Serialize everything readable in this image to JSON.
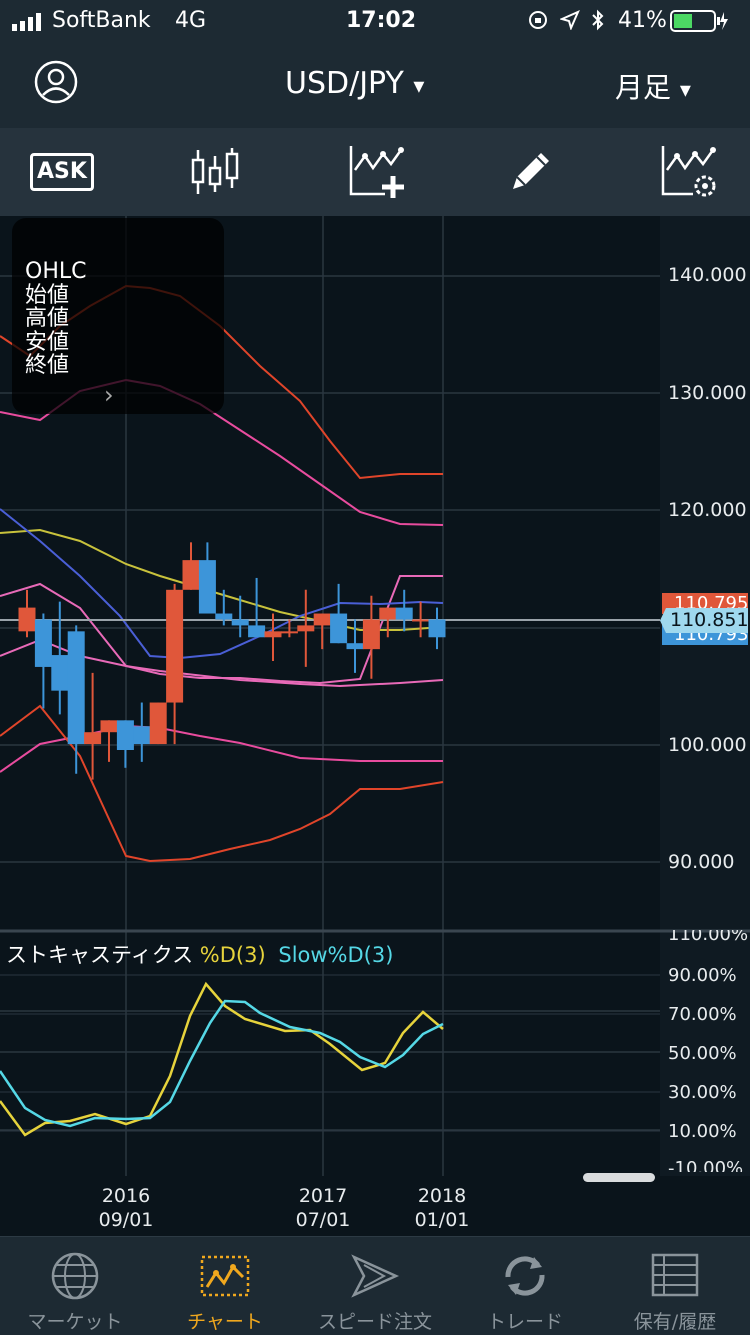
{
  "status_bar": {
    "carrier": "SoftBank",
    "network": "4G",
    "time": "17:02",
    "battery": "41%"
  },
  "header": {
    "pair": "USD/JPY",
    "pair_caret": "▾",
    "period": "月足",
    "period_caret": "▾"
  },
  "toolbar": {
    "ask_label": "ASK"
  },
  "ohlc_box": {
    "title": "OHLC",
    "open": "始値",
    "high": "高値",
    "low": "安値",
    "close": "終値",
    "arrow": "›"
  },
  "price_axis": {
    "ticks": [
      "140.000",
      "130.000",
      "120.000",
      "110.000",
      "100.000",
      "90.000"
    ],
    "bid_tag": "110.795",
    "ask_tag": "110.793",
    "current": "110.851"
  },
  "stoch": {
    "title": "ストキャスティクス",
    "d_label": "%D(3)",
    "slow_label": "Slow%D(3)",
    "ticks": [
      "110.00%",
      "90.00%",
      "70.00%",
      "50.00%",
      "30.00%",
      "10.00%",
      "-10.00%"
    ]
  },
  "time_axis": [
    {
      "year": "2016",
      "date": "09/01"
    },
    {
      "year": "2017",
      "date": "07/01"
    },
    {
      "year": "2018",
      "date": "01/01"
    }
  ],
  "tabs": [
    {
      "label": "マーケット"
    },
    {
      "label": "チャート"
    },
    {
      "label": "スピード注文"
    },
    {
      "label": "トレード"
    },
    {
      "label": "保有/履歴"
    }
  ],
  "colors": {
    "up": "#e0573a",
    "down": "#3d95d9",
    "accent": "#f0a81e",
    "stoch_d": "#e6d33c",
    "stoch_slow": "#55d8e6"
  },
  "chart_data": {
    "type": "candlestick",
    "price_range": [
      86,
      146
    ],
    "candles": [
      {
        "o": 111.0,
        "h": 114.5,
        "l": 110.5,
        "c": 113.0
      },
      {
        "o": 112.0,
        "h": 112.5,
        "l": 104.5,
        "c": 108.0
      },
      {
        "o": 109.0,
        "h": 113.5,
        "l": 104.0,
        "c": 106.0
      },
      {
        "o": 111.0,
        "h": 111.5,
        "l": 99.0,
        "c": 101.5
      },
      {
        "o": 101.5,
        "h": 107.5,
        "l": 98.5,
        "c": 102.5
      },
      {
        "o": 102.5,
        "h": 103.5,
        "l": 100.0,
        "c": 103.5
      },
      {
        "o": 103.5,
        "h": 103.5,
        "l": 99.5,
        "c": 101.0
      },
      {
        "o": 103.0,
        "h": 105.0,
        "l": 100.0,
        "c": 101.5
      },
      {
        "o": 101.5,
        "h": 105.0,
        "l": 101.5,
        "c": 105.0
      },
      {
        "o": 105.0,
        "h": 115.0,
        "l": 101.5,
        "c": 114.5
      },
      {
        "o": 114.5,
        "h": 118.5,
        "l": 114.5,
        "c": 117.0
      },
      {
        "o": 117.0,
        "h": 118.5,
        "l": 112.5,
        "c": 112.5
      },
      {
        "o": 112.5,
        "h": 114.5,
        "l": 111.5,
        "c": 112.0
      },
      {
        "o": 112.0,
        "h": 114.0,
        "l": 110.5,
        "c": 111.5
      },
      {
        "o": 111.5,
        "h": 115.5,
        "l": 110.5,
        "c": 110.5
      },
      {
        "o": 110.5,
        "h": 112.5,
        "l": 108.5,
        "c": 111.0
      },
      {
        "o": 111.0,
        "h": 112.0,
        "l": 110.5,
        "c": 111.0
      },
      {
        "o": 111.0,
        "h": 114.5,
        "l": 108.0,
        "c": 111.5
      },
      {
        "o": 111.5,
        "h": 112.5,
        "l": 109.5,
        "c": 112.5
      },
      {
        "o": 112.5,
        "h": 115.0,
        "l": 110.0,
        "c": 110.0
      },
      {
        "o": 110.0,
        "h": 112.0,
        "l": 107.5,
        "c": 109.5
      },
      {
        "o": 109.5,
        "h": 114.0,
        "l": 107.0,
        "c": 112.0
      },
      {
        "o": 112.0,
        "h": 113.0,
        "l": 110.5,
        "c": 113.0
      },
      {
        "o": 113.0,
        "h": 114.5,
        "l": 111.0,
        "c": 112.0
      },
      {
        "o": 112.0,
        "h": 113.5,
        "l": 110.5,
        "c": 112.0
      },
      {
        "o": 112.0,
        "h": 113.0,
        "l": 109.5,
        "c": 110.5
      }
    ]
  }
}
